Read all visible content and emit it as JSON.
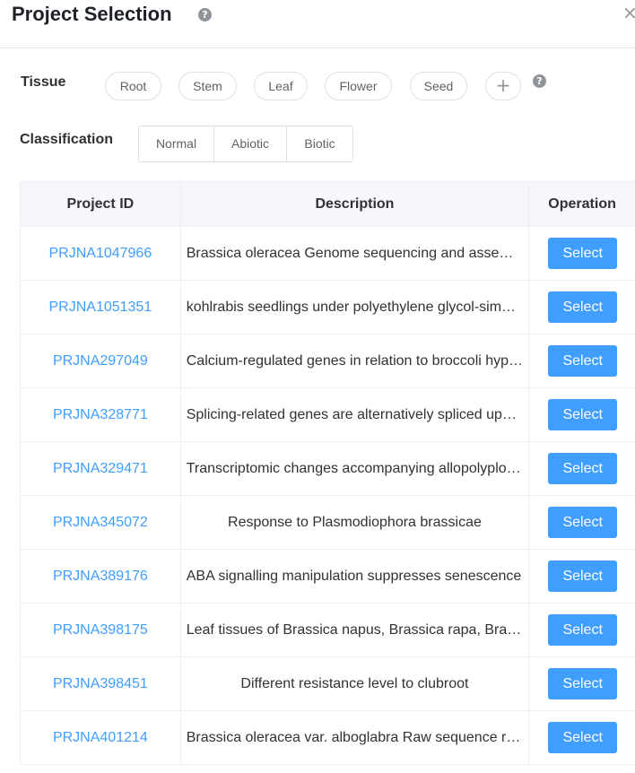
{
  "dialog": {
    "title": "Project Selection",
    "help_glyph": "?",
    "close_glyph": "×"
  },
  "tissue": {
    "label": "Tissue",
    "options": [
      "Root",
      "Stem",
      "Leaf",
      "Flower",
      "Seed"
    ],
    "add_glyph": "+",
    "help_glyph": "?"
  },
  "classification": {
    "label": "Classification",
    "options": [
      "Normal",
      "Abiotic",
      "Biotic"
    ]
  },
  "table": {
    "headers": {
      "project_id": "Project ID",
      "description": "Description",
      "operation": "Operation"
    },
    "select_label": "Select",
    "rows": [
      {
        "id": "PRJNA1047966",
        "description": "Brassica oleracea Genome sequencing and assembly"
      },
      {
        "id": "PRJNA1051351",
        "description": "kohlrabis seedlings under polyethylene glycol-simulated drought stress"
      },
      {
        "id": "PRJNA297049",
        "description": "Calcium-regulated genes in relation to broccoli hypocotyls"
      },
      {
        "id": "PRJNA328771",
        "description": "Splicing-related genes are alternatively spliced upon changes"
      },
      {
        "id": "PRJNA329471",
        "description": "Transcriptomic changes accompanying allopolyploidization"
      },
      {
        "id": "PRJNA345072",
        "description": "Response to Plasmodiophora brassicae"
      },
      {
        "id": "PRJNA389176",
        "description": "ABA signalling manipulation suppresses senescence"
      },
      {
        "id": "PRJNA398175",
        "description": "Leaf tissues of Brassica napus, Brassica rapa, Brassica oleracea"
      },
      {
        "id": "PRJNA398451",
        "description": "Different resistance level to clubroot"
      },
      {
        "id": "PRJNA401214",
        "description": "Brassica oleracea var. alboglabra Raw sequence reads"
      }
    ]
  }
}
